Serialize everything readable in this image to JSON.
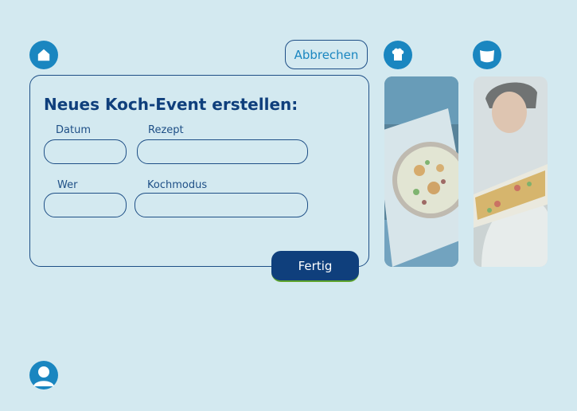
{
  "nav": {
    "home_icon": "home-icon",
    "profile_icon": "user-icon",
    "chef_hat_icon": "chef-hat-icon",
    "cup_icon": "cup-icon",
    "accent_color": "#1a86c0"
  },
  "actions": {
    "cancel_label": "Abbrechen",
    "done_label": "Fertig"
  },
  "form": {
    "title": "Neues Koch-Event erstellen:",
    "fields": {
      "datum": {
        "label": "Datum",
        "value": ""
      },
      "rezept": {
        "label": "Rezept",
        "value": ""
      },
      "wer": {
        "label": "Wer",
        "value": ""
      },
      "kochmodus": {
        "label": "Kochmodus",
        "value": ""
      }
    }
  },
  "gallery": {
    "items": [
      {
        "subject": "soup bowl with toppings"
      },
      {
        "subject": "man holding baking dish"
      }
    ]
  },
  "colors": {
    "background": "#d3e9f0",
    "primary_dark": "#0f3f7c",
    "border": "#1e4f86",
    "done_underline": "#5ea42c"
  }
}
